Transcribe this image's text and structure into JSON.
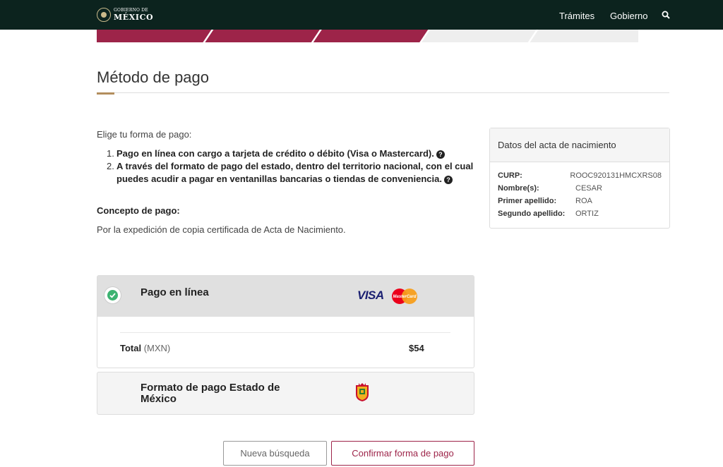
{
  "header": {
    "logo_small": "GOBIERNO DE",
    "logo_big": "MÉXICO",
    "nav": [
      "Trámites",
      "Gobierno"
    ],
    "search_icon": "search-icon"
  },
  "progress": {
    "steps_completed": 3,
    "steps_total": 5,
    "active_color": "#9d2449",
    "inactive_color": "#eeeeee"
  },
  "page": {
    "title": "Método de pago",
    "intro": "Elige tu forma de pago:",
    "options": [
      {
        "num": "1.",
        "text": "Pago en línea con cargo a tarjeta de crédito o débito (Visa o Mastercard)."
      },
      {
        "num": "2.",
        "text": "A través del formato de pago del estado, dentro del territorio nacional, con el cual puedes acudir a pagar en ventanillas bancarias o tiendas de conveniencia."
      }
    ],
    "help_glyph": "?",
    "concept_label": "Concepto de pago:",
    "concept_text": "Por la expedición de copia certificada de Acta de Nacimiento."
  },
  "record": {
    "title": "Datos del acta de nacimiento",
    "rows": [
      {
        "key": "CURP:",
        "value": "ROOC920131HMCXRS08"
      },
      {
        "key": "Nombre(s):",
        "value": "CESAR"
      },
      {
        "key": "Primer apellido:",
        "value": "ROA"
      },
      {
        "key": "Segundo apellido:",
        "value": "ORTIZ"
      }
    ]
  },
  "payment": {
    "online": {
      "label": "Pago en línea",
      "selected": true,
      "visa": "VISA",
      "mastercard": "MasterCard",
      "total_label": "Total",
      "total_unit": "(MXN)",
      "total_value": "$54"
    },
    "state": {
      "label": "Formato de pago Estado de México",
      "icon": "state-crest-icon"
    }
  },
  "buttons": {
    "new_search": "Nueva búsqueda",
    "confirm": "Confirmar forma de pago"
  },
  "colors": {
    "brand": "#9d2449",
    "header_bg": "#0c231e",
    "accent_gold": "#b38e5d",
    "check_green": "#3cb371"
  }
}
